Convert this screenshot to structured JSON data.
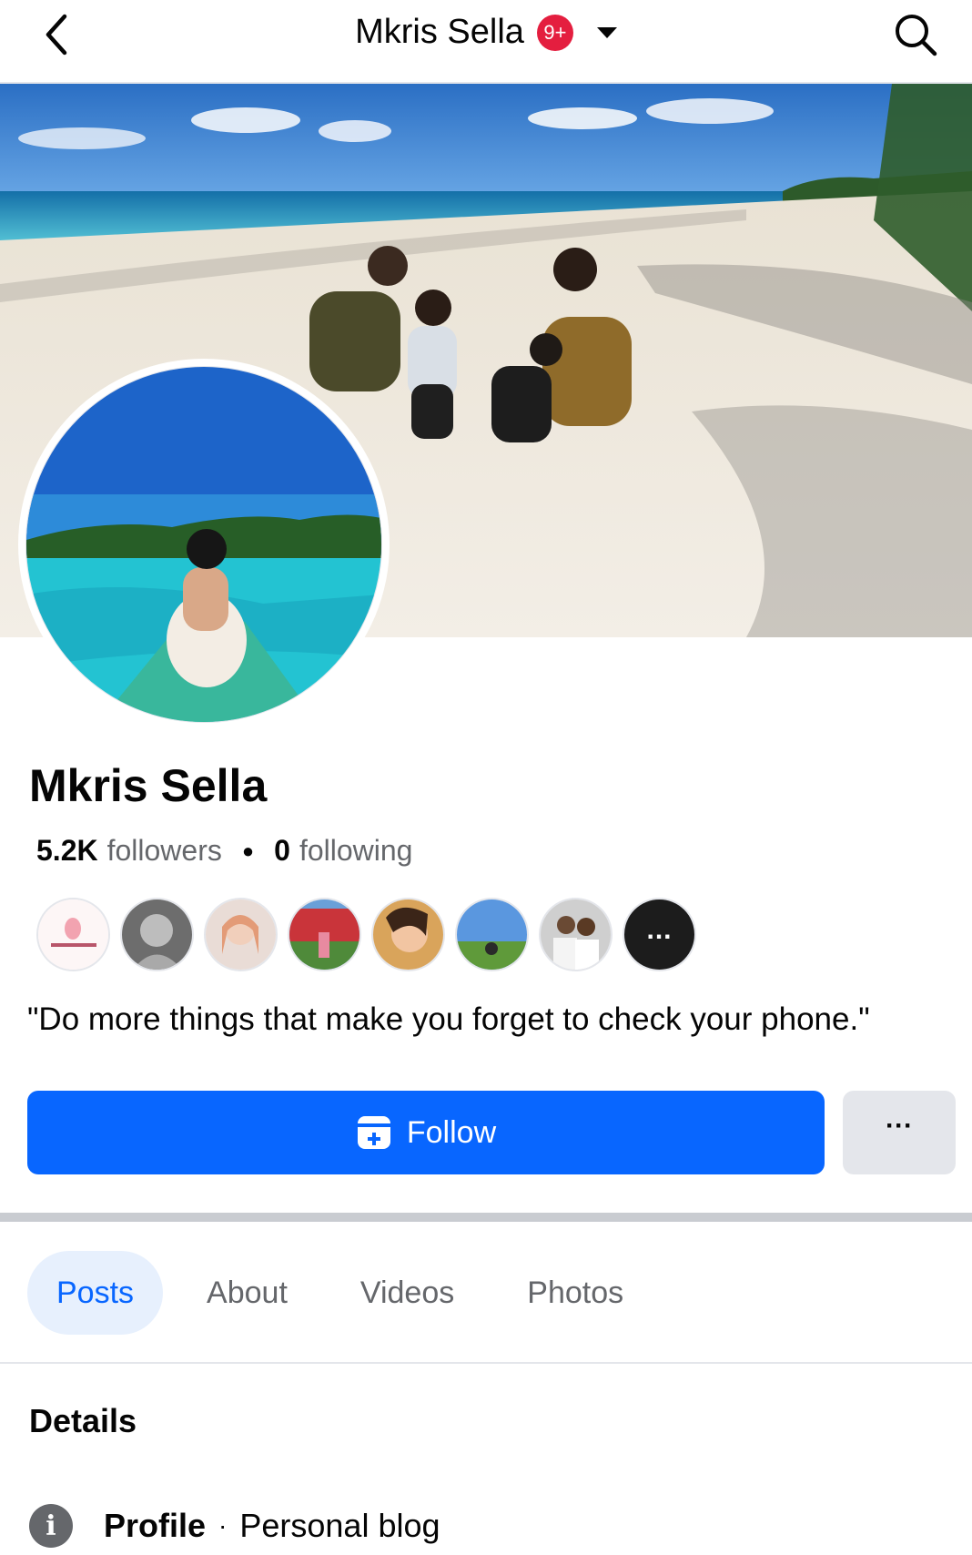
{
  "header": {
    "title": "Mkris Sella",
    "badge": "9+"
  },
  "profile": {
    "name": "Mkris Sella",
    "followers_count": "5.2K",
    "followers_label": "followers",
    "following_count": "0",
    "following_label": "following",
    "bio": "\"Do more things that make you forget to check your phone.\""
  },
  "actions": {
    "follow_label": "Follow",
    "more_label": "···"
  },
  "tabs": [
    {
      "label": "Posts",
      "active": true
    },
    {
      "label": "About",
      "active": false
    },
    {
      "label": "Videos",
      "active": false
    },
    {
      "label": "Photos",
      "active": false
    }
  ],
  "details": {
    "title": "Details",
    "profile_label": "Profile",
    "profile_value": "Personal blog"
  },
  "colors": {
    "accent": "#0866ff",
    "badge": "#e41e3f",
    "secondary_button": "#e4e6eb"
  },
  "icons": {
    "back": "chevron-left-icon",
    "search": "search-icon",
    "dropdown": "caret-down-icon",
    "follow": "follow-icon",
    "info": "info-icon"
  }
}
